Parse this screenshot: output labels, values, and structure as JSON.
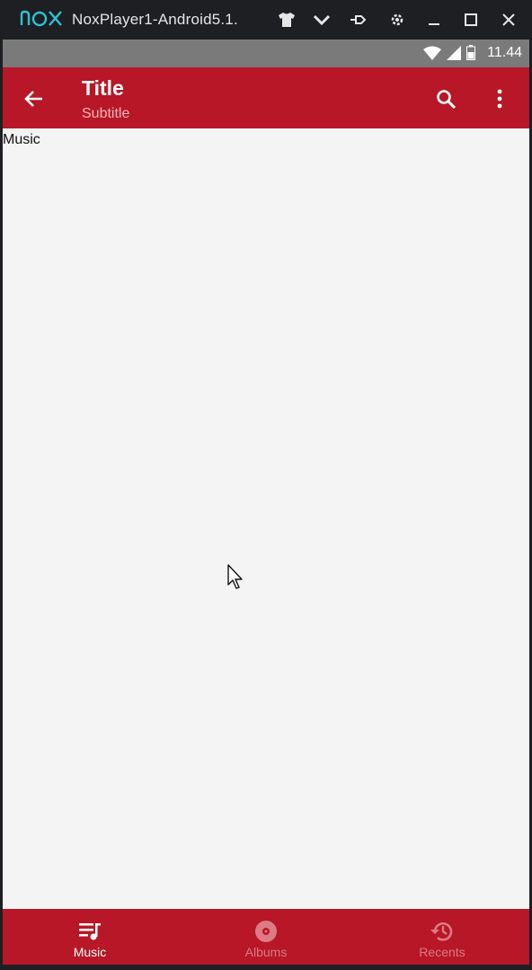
{
  "window": {
    "title": "NoxPlayer1-Android5.1.",
    "logo_text": "nox",
    "controls": [
      "tshirt-icon",
      "chevron-down-icon",
      "pin-icon",
      "gear-icon",
      "minimize-icon",
      "maximize-icon",
      "close-icon"
    ]
  },
  "status_bar": {
    "time": "11.44",
    "icons": [
      "wifi-icon",
      "signal-icon",
      "battery-icon"
    ]
  },
  "app_bar": {
    "title": "Title",
    "subtitle": "Subtitle",
    "color": "#b71726"
  },
  "content": {
    "text": "Music"
  },
  "bottom_nav": {
    "items": [
      {
        "label": "Music",
        "icon": "music-list-icon",
        "active": true
      },
      {
        "label": "Albums",
        "icon": "album-disc-icon",
        "active": false
      },
      {
        "label": "Recents",
        "icon": "history-icon",
        "active": false
      }
    ]
  }
}
